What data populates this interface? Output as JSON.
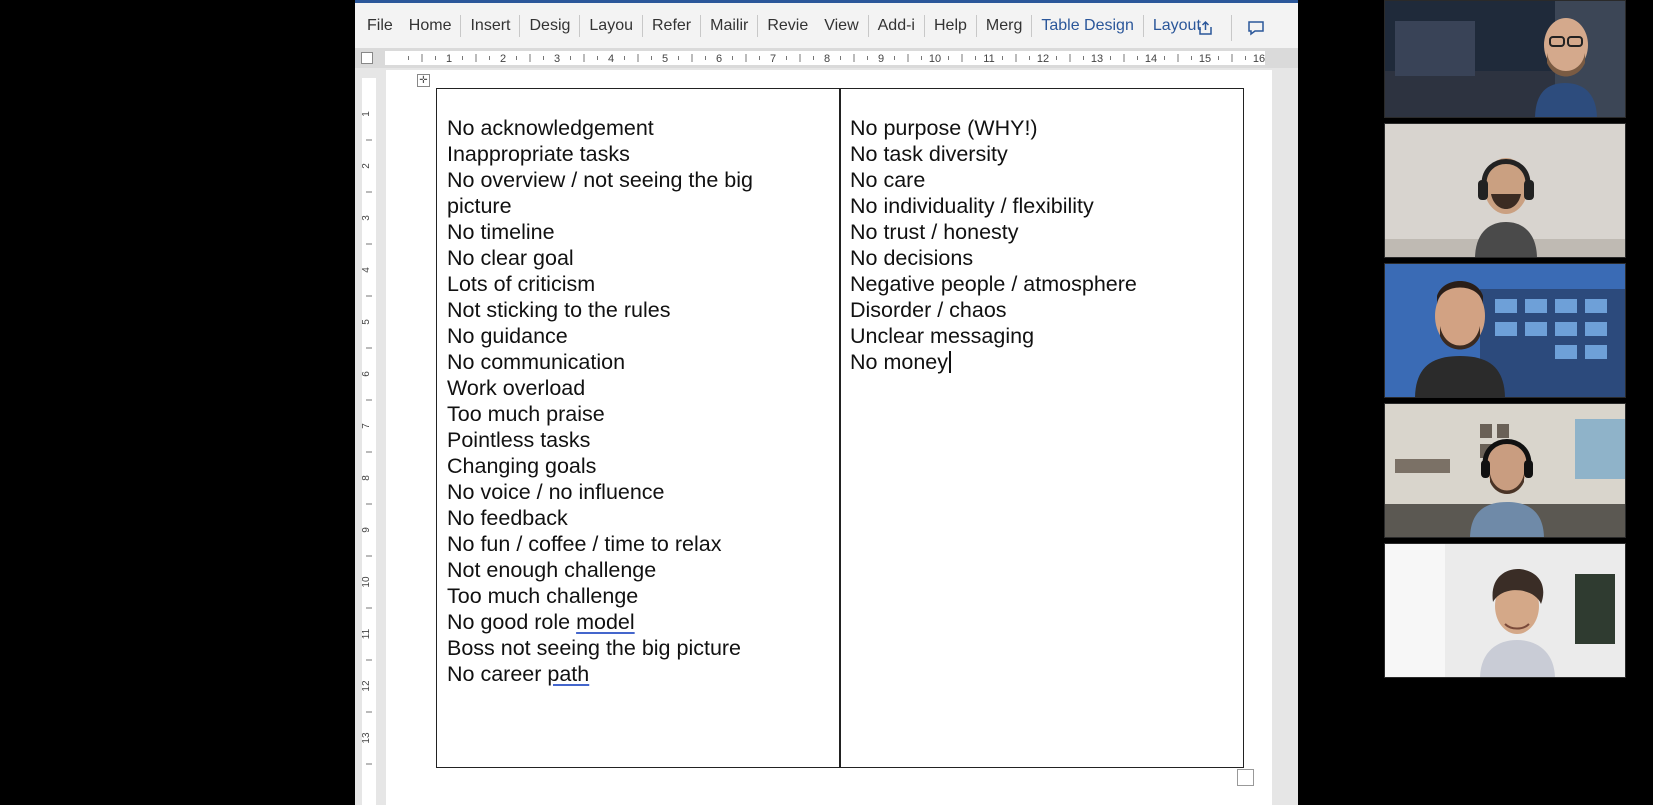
{
  "ribbon": {
    "tabs": [
      {
        "label": "File"
      },
      {
        "label": "Home"
      },
      {
        "label": "Insert"
      },
      {
        "label": "Desig"
      },
      {
        "label": "Layou"
      },
      {
        "label": "Refer"
      },
      {
        "label": "Mailir"
      },
      {
        "label": "Revie"
      },
      {
        "label": "View"
      },
      {
        "label": "Add-i"
      },
      {
        "label": "Help"
      },
      {
        "label": "Merg"
      },
      {
        "label": "Table Design"
      },
      {
        "label": "Layout"
      }
    ],
    "share_icon": "share-icon",
    "comments_icon": "comment-icon"
  },
  "ruler": {
    "numbers": [
      "1",
      "2",
      "3",
      "4",
      "5",
      "6",
      "7",
      "8",
      "9",
      "10",
      "11",
      "12",
      "13",
      "14",
      "15",
      "16"
    ],
    "vertical_numbers": [
      "1",
      "2",
      "3",
      "4",
      "5",
      "6",
      "7",
      "8",
      "9",
      "10",
      "11",
      "12",
      "13"
    ]
  },
  "document": {
    "left_column": [
      "No acknowledgement",
      "Inappropriate tasks",
      "No overview / not seeing the big",
      "picture",
      "No timeline",
      "No clear goal",
      "Lots of criticism",
      "Not sticking to the rules",
      "No guidance",
      "No communication",
      "Work overload",
      "Too much praise",
      "Pointless tasks",
      "Changing goals",
      "No voice / no influence",
      "No feedback",
      "No fun / coffee / time to relax",
      "Not enough challenge",
      "Too much challenge",
      "No good role ",
      "Boss not seeing the big picture",
      "No career "
    ],
    "left_underlined": {
      "role_model": "model",
      "career_path": "path"
    },
    "right_column": [
      "No purpose (WHY!)",
      "No task diversity",
      "No care",
      "No individuality / flexibility",
      "No trust / honesty",
      "No decisions",
      "Negative people / atmosphere",
      "Disorder / chaos",
      "Unclear messaging",
      "No money"
    ]
  },
  "video_tiles": [
    {
      "name": "participant-1",
      "bg": "#1f2a3a"
    },
    {
      "name": "participant-2",
      "bg": "#d8d4cf"
    },
    {
      "name": "participant-3",
      "bg": "#3a6bb5"
    },
    {
      "name": "participant-4",
      "bg": "#d9d5cc"
    },
    {
      "name": "participant-5",
      "bg": "#ebebeb"
    }
  ],
  "colors": {
    "accent": "#2b579a",
    "text": "#111111",
    "spelling_underline": "#4466cc"
  }
}
